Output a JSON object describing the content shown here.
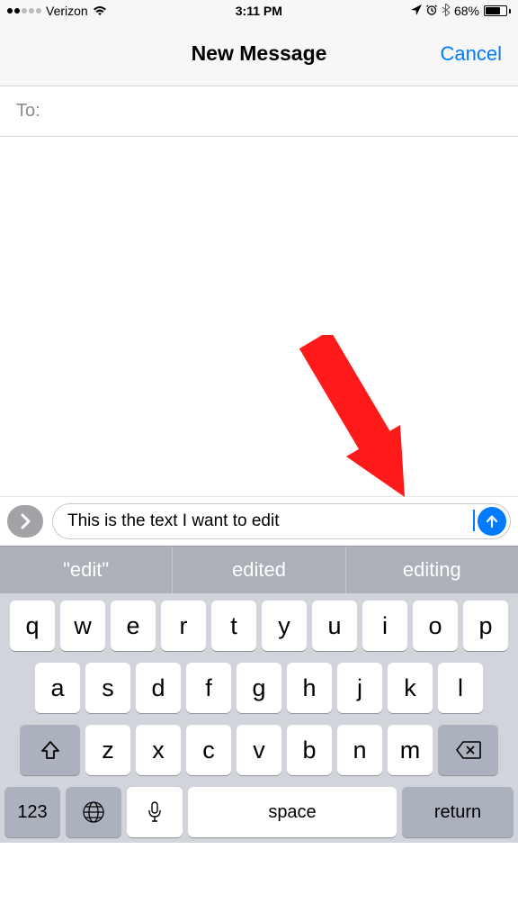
{
  "status": {
    "carrier": "Verizon",
    "time": "3:11 PM",
    "battery_pct": "68%"
  },
  "nav": {
    "title": "New Message",
    "cancel": "Cancel"
  },
  "to": {
    "label": "To:"
  },
  "input": {
    "value": "This is the text I want to edit"
  },
  "predictive": {
    "s1": "\"edit\"",
    "s2": "edited",
    "s3": "editing"
  },
  "keyboard": {
    "row1": [
      "q",
      "w",
      "e",
      "r",
      "t",
      "y",
      "u",
      "i",
      "o",
      "p"
    ],
    "row2": [
      "a",
      "s",
      "d",
      "f",
      "g",
      "h",
      "j",
      "k",
      "l"
    ],
    "row3": [
      "z",
      "x",
      "c",
      "v",
      "b",
      "n",
      "m"
    ],
    "numkey": "123",
    "space": "space",
    "return": "return"
  }
}
